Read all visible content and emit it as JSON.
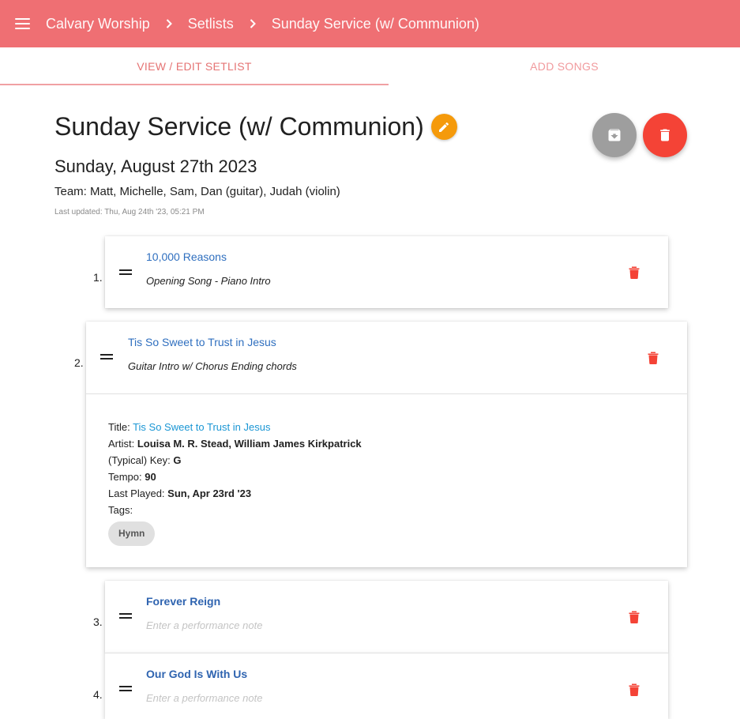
{
  "appbar": {
    "breadcrumbs": [
      "Calvary Worship",
      "Setlists",
      "Sunday Service (w/ Communion)"
    ],
    "menu_icon": "hamburger-icon",
    "separator_icon": "chevron-right-icon"
  },
  "tabs": [
    {
      "label": "VIEW / EDIT SETLIST",
      "active": true
    },
    {
      "label": "ADD SONGS",
      "active": false
    }
  ],
  "setlist": {
    "title": "Sunday Service (w/ Communion)",
    "date": "Sunday, August 27th 2023",
    "team": "Team: Matt, Michelle, Sam, Dan (guitar), Judah (violin)",
    "last_updated": "Last updated: Thu, Aug 24th '23, 05:21 PM"
  },
  "songs": [
    {
      "number": "1.",
      "title": "10,000 Reasons",
      "note": "Opening Song - Piano Intro"
    },
    {
      "number": "2.",
      "title": "Tis So Sweet to Trust in Jesus",
      "note": "Guitar Intro w/ Chorus Ending chords"
    },
    {
      "number": "3.",
      "title": "Forever Reign",
      "note": "Enter a performance note"
    },
    {
      "number": "4.",
      "title": "Our God Is With Us",
      "note": "Enter a performance note"
    }
  ],
  "expanded_song": {
    "title_label": "Title: ",
    "title_value": "Tis So Sweet to Trust in Jesus",
    "artist_label": "Artist: ",
    "artist_value": "Louisa M. R. Stead, William James Kirkpatrick",
    "key_label": "(Typical) Key: ",
    "key_value": "G",
    "tempo_label": "Tempo: ",
    "tempo_value": "90",
    "last_played_label": "Last Played: ",
    "last_played_value": "Sun, Apr 23rd '23",
    "tags_label": "Tags:",
    "tags": [
      "Hymn"
    ]
  },
  "colors": {
    "appbar": "#ef6f73",
    "edit_fab": "#f59a0b",
    "delete": "#f44336",
    "archive_fab": "#9e9e9e",
    "song_link": "#2f6fbf"
  }
}
